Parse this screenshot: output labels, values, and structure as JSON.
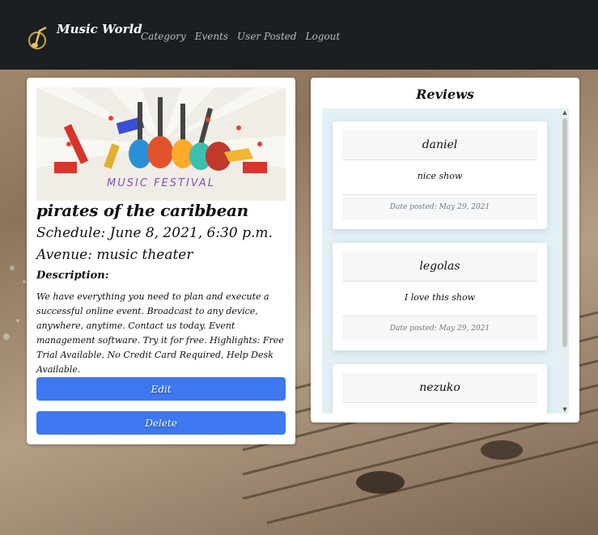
{
  "navbar": {
    "brand": "Music World",
    "links": [
      "Category",
      "Events",
      "User Posted",
      "Logout"
    ]
  },
  "event": {
    "image_caption": "MUSIC FESTIVAL",
    "title": "pirates of the caribbean",
    "schedule": "Schedule: June 8, 2021, 6:30 p.m.",
    "venue": "Avenue: music theater",
    "description_label": "Description:",
    "description": "We have everything you need to plan and execute a successful online event. Broadcast to any device, anywhere, anytime. Contact us today. Event management software. Try it for free. Highlights: Free Trial Available, No Credit Card Required, Help Desk Available.",
    "edit_label": "Edit",
    "delete_label": "Delete"
  },
  "reviews": {
    "title": "Reviews",
    "items": [
      {
        "name": "daniel",
        "comment": "nice show",
        "date": "Date posted: May 29, 2021"
      },
      {
        "name": "legolas",
        "comment": "I love this show",
        "date": "Date posted: May 29, 2021"
      },
      {
        "name": "nezuko",
        "comment": "",
        "date": ""
      }
    ]
  },
  "colors": {
    "navbar": "#1b1f22",
    "button": "#3d78f0"
  }
}
